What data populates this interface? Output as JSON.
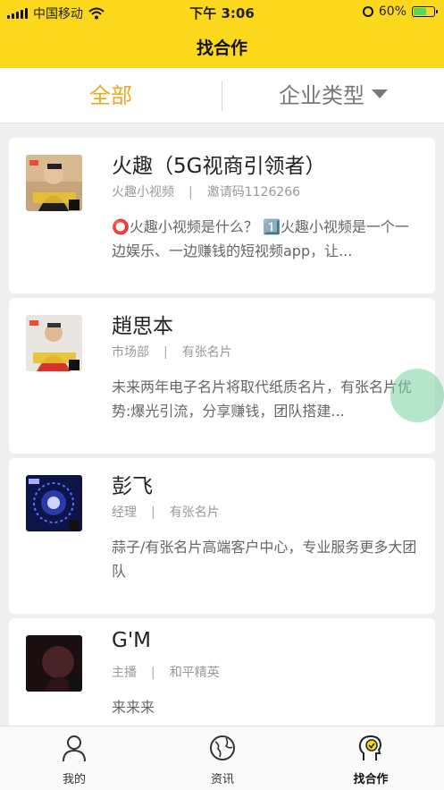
{
  "status_bar": {
    "carrier": "中国移动",
    "time": "下午 3:06",
    "battery": "60%",
    "battery_level": 0.6,
    "icons": [
      "signal-icon",
      "wifi-icon",
      "alarm-icon",
      "battery-icon"
    ]
  },
  "nav": {
    "title": "找合作"
  },
  "filter": {
    "all_label": "全部",
    "type_label": "企业类型",
    "active_color": "#f0a81e"
  },
  "cards": [
    {
      "name": "火趣（5G视商引领者）",
      "company": "火趣小视频",
      "detail": "邀请码1126266",
      "description": "⭕火趣小视频是什么？ 1️⃣火趣小视频是一个一边娱乐、一边赚钱的短视频app，让..."
    },
    {
      "name": "趙思本",
      "company": "市场部",
      "detail": "有张名片",
      "description": "未来两年电子名片将取代纸质名片，有张名片优势:爆光引流，分享赚钱，团队搭建..."
    },
    {
      "name": "彭飞",
      "company": "经理",
      "detail": "有张名片",
      "description": "蒜子/有张名片高端客户中心，专业服务更多大团队"
    },
    {
      "name": "G'M",
      "company": "主播",
      "detail": "和平精英",
      "description": "来来来"
    }
  ],
  "tabbar": {
    "tabs": [
      {
        "label": "我的",
        "icon": "person-icon"
      },
      {
        "label": "资讯",
        "icon": "globe-icon"
      },
      {
        "label": "找合作",
        "icon": "cooperation-icon",
        "active": true
      }
    ]
  },
  "colors": {
    "brand_yellow": "#fcd81c",
    "background": "#efefef"
  }
}
